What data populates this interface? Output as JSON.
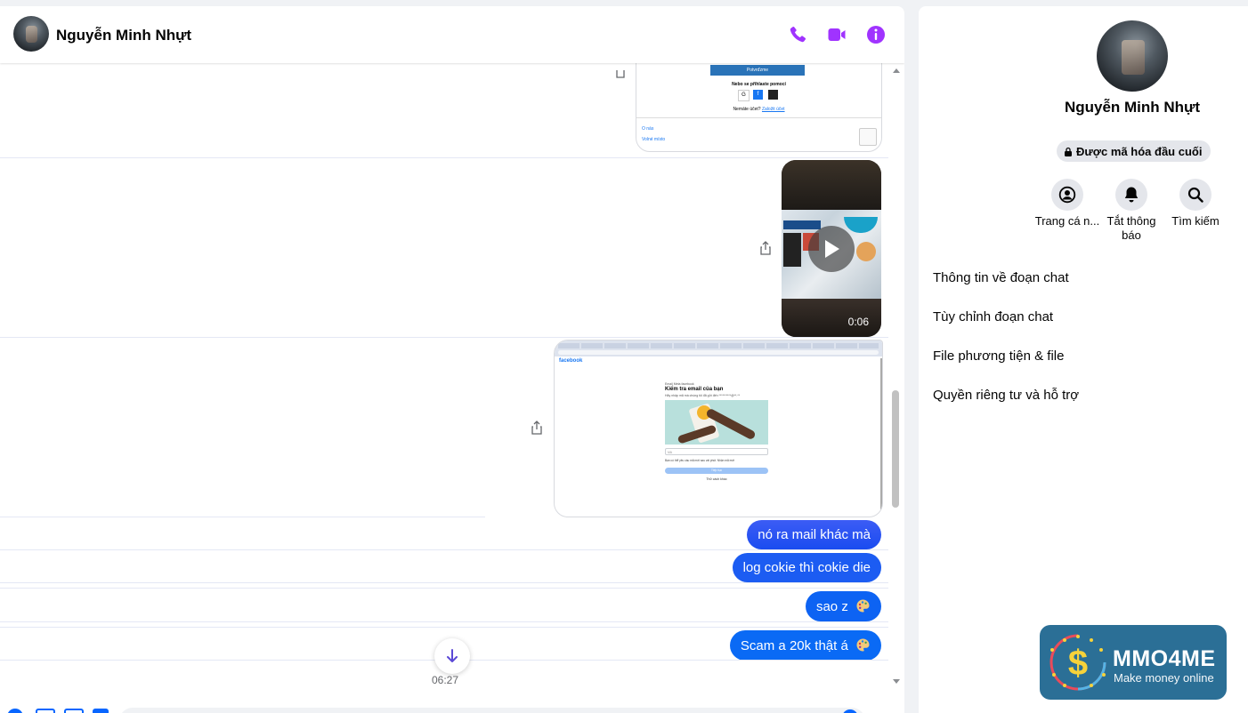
{
  "conversation": {
    "contact_name": "Nguyễn Minh Nhựt",
    "colors": {
      "accent": "#a033ff",
      "bubble": "#0a7cff",
      "link": "#1877f2"
    }
  },
  "header": {
    "icons": [
      "phone-icon",
      "video-call-icon",
      "info-icon"
    ]
  },
  "messages": {
    "video_duration": "0:06",
    "screenshot_top": {
      "button": "Potvrďzme",
      "login_text": "Nebo se přihlaste pomocí",
      "signup_prompt": "Nemáte účet?",
      "signup_link": "Založit účet",
      "footer_a": "O nás",
      "footer_b": "Volné místo"
    },
    "screenshot_email": {
      "brand": "facebook",
      "heading_small": "Kiểm tra email của bạn",
      "heading_pre": "Email Meta facebook",
      "sub": "Hãy nhập mã mà chúng tôi đã gửi đến **********@**.**",
      "field": "Mã",
      "checkbox": "Bạn có thể yêu cầu mã mới sau vài phút. Nhận mã mới",
      "button": "Tiếp tục",
      "secondary": "Thử cách khác"
    },
    "texts": [
      "nó ra mail khác mà",
      "log cokie thì cokie die",
      "sao z",
      "Scam a 20k thật á"
    ],
    "timestamp": "06:27"
  },
  "side_panel": {
    "name": "Nguyễn Minh Nhựt",
    "encryption_label": "Được mã hóa đầu cuối",
    "actions": [
      {
        "label": "Trang cá n...",
        "icon": "profile-icon"
      },
      {
        "label": "Tắt thông báo",
        "icon": "bell-icon"
      },
      {
        "label": "Tìm kiếm",
        "icon": "search-icon"
      }
    ],
    "menu": [
      "Thông tin về đoạn chat",
      "Tùy chỉnh đoạn chat",
      "File phương tiện & file",
      "Quyền riêng tư và hỗ trợ"
    ]
  },
  "watermark": {
    "title": "MMO4ME",
    "subtitle": "Make money online"
  }
}
